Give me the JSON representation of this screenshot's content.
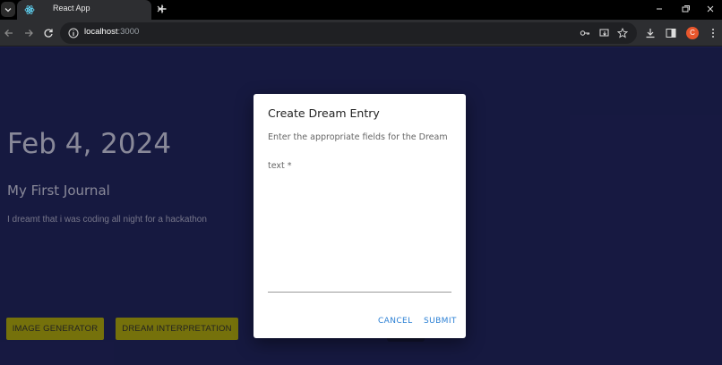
{
  "browser": {
    "tab_title": "React App",
    "url_host": "localhost",
    "url_port": ":3000",
    "profile_initial": "C"
  },
  "journal": {
    "date": "Feb 4, 2024",
    "title": "My First Journal",
    "body": "I dreamt that i was coding all night for a hackathon",
    "buttons": {
      "image_generator": "IMAGE GENERATOR",
      "dream_interpretation": "DREAM INTERPRETATION"
    }
  },
  "dialog": {
    "title": "Create Dream Entry",
    "description": "Enter the appropriate fields for the Dream",
    "field_label": "text *",
    "field_value": "",
    "cancel_label": "CANCEL",
    "submit_label": "SUBMIT"
  },
  "colors": {
    "page_bg": "#1c1f4f",
    "action_button": "#8f8a0e",
    "dialog_accent": "#2a7fd4"
  }
}
